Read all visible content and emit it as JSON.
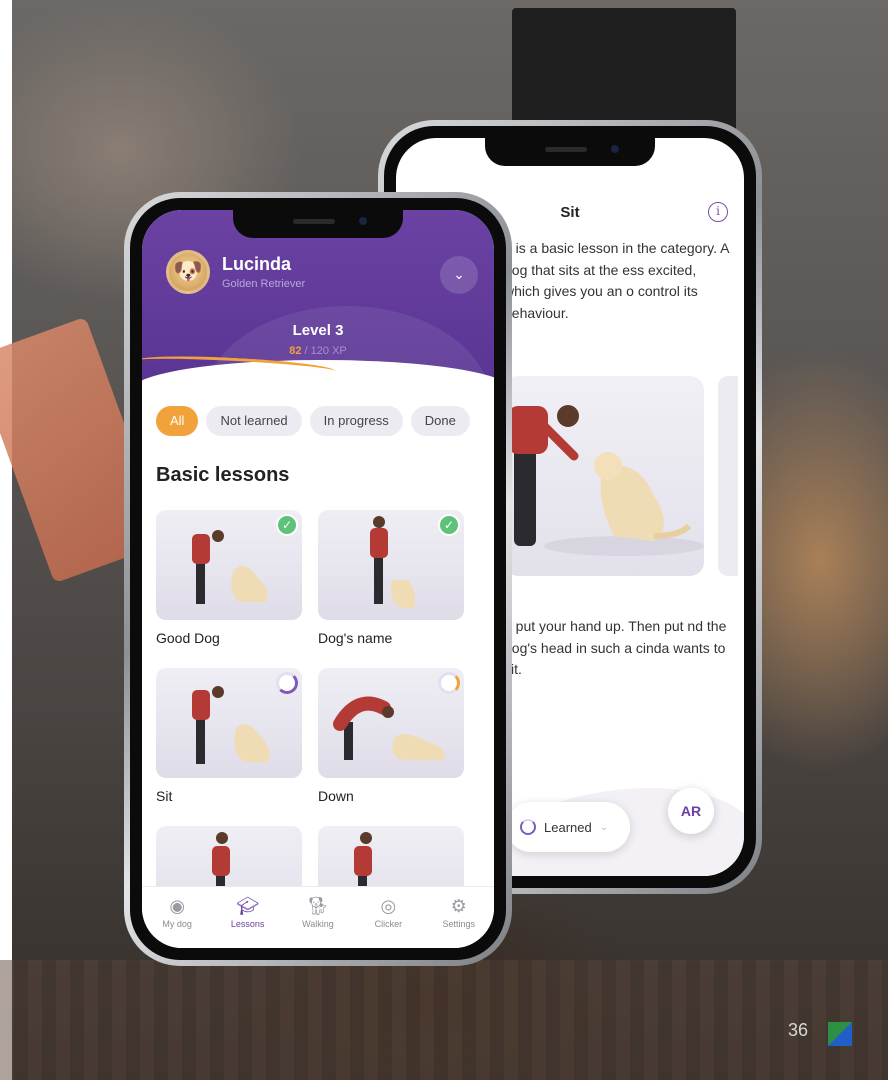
{
  "back_screen": {
    "title": "Sit",
    "intro": "d is a basic lesson in the category. A dog that sits at the ess excited, which gives you an o control its behaviour.",
    "instructions": "d put your hand up. Then put nd the dog's head in such a cinda wants to sit.",
    "learned_label": "Learned",
    "ar_label": "AR"
  },
  "front_screen": {
    "dog_name": "Lucinda",
    "breed": "Golden Retriever",
    "level": "Level 3",
    "xp_current": "82",
    "xp_total": "/ 120 XP",
    "filters": [
      "All",
      "Not learned",
      "In progress",
      "Done"
    ],
    "section_title": "Basic lessons",
    "lessons": [
      {
        "label": "Good Dog",
        "status": "done"
      },
      {
        "label": "Dog's name",
        "status": "done"
      },
      {
        "label": "Sit",
        "status": "in-progress"
      },
      {
        "label": "Down",
        "status": "in-progress"
      },
      {
        "label": "",
        "status": "none"
      },
      {
        "label": "",
        "status": "none"
      }
    ],
    "tabs": [
      {
        "label": "My dog",
        "icon": "dog-avatar-icon"
      },
      {
        "label": "Lessons",
        "icon": "graduation-cap-icon"
      },
      {
        "label": "Walking",
        "icon": "dog-walking-icon"
      },
      {
        "label": "Clicker",
        "icon": "clicker-icon"
      },
      {
        "label": "Settings",
        "icon": "gear-icon"
      }
    ]
  },
  "page_number": "36",
  "colors": {
    "purple": "#5a3594",
    "orange": "#f2a23a",
    "green": "#5ec27a"
  }
}
